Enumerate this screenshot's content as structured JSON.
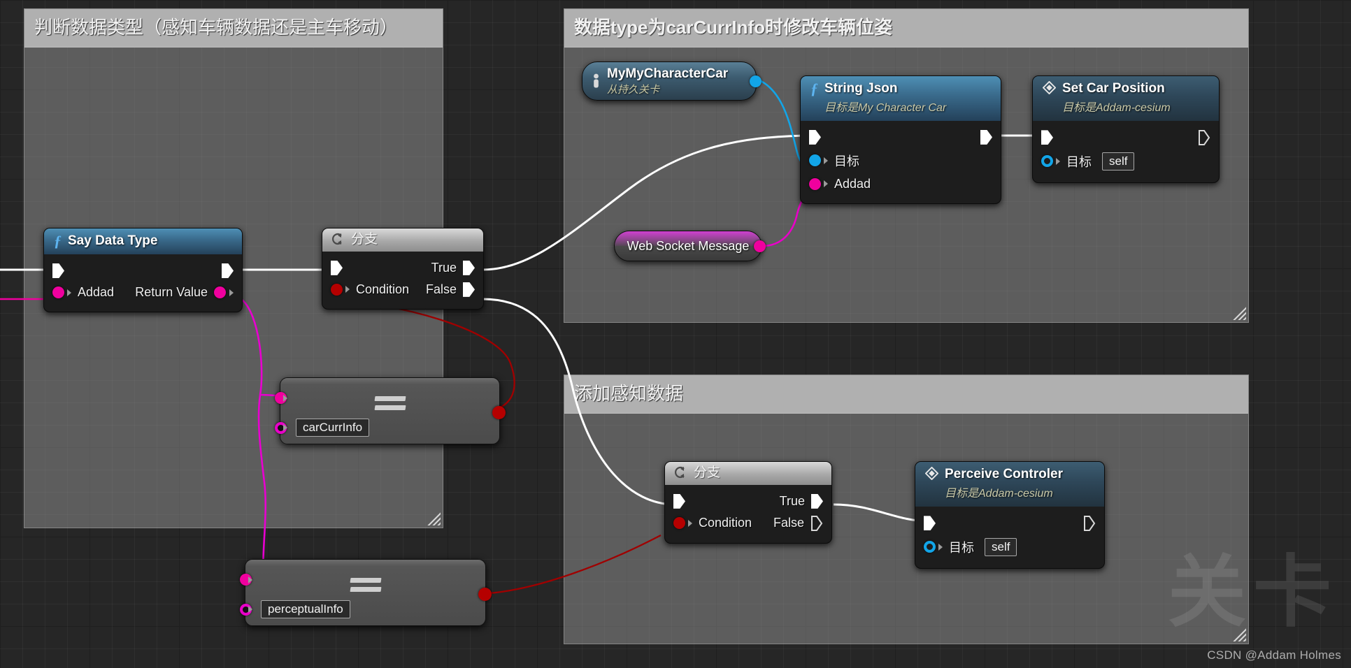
{
  "watermark": {
    "big": "关卡",
    "credit": "CSDN @Addam Holmes"
  },
  "comments": [
    {
      "id": "comment-data-type",
      "title": "判断数据类型（感知车辆数据还是主车移动）"
    },
    {
      "id": "comment-car-pose",
      "title": "数据type为carCurrInfo时修改车辆位姿"
    },
    {
      "id": "comment-perception",
      "title": "添加感知数据"
    }
  ],
  "nodes": {
    "my_character_car": {
      "title": "MyMyCharacterCar",
      "subtitle": "从持久关卡",
      "icon": "person-icon",
      "out_pin": "cyan"
    },
    "string_json": {
      "title": "String Json",
      "subtitle": "目标是My Character Car",
      "icon": "function-icon",
      "inputs": [
        {
          "label": "目标",
          "pin": "cyan"
        },
        {
          "label": "Addad",
          "pin": "magenta"
        }
      ]
    },
    "set_car_position": {
      "title": "Set Car Position",
      "subtitle": "目标是Addam-cesium",
      "icon": "diamond-icon",
      "inputs": [
        {
          "label": "目标",
          "pin": "cyan-ring",
          "value": "self"
        }
      ]
    },
    "web_socket_message": {
      "title": "Web Socket Message",
      "out_pin": "magenta"
    },
    "say_data_type": {
      "title": "Say Data Type",
      "icon": "function-icon",
      "input_label": "Addad",
      "output_label": "Return Value"
    },
    "branch_top": {
      "title": "分支",
      "icon": "branch-icon",
      "condition_label": "Condition",
      "true_label": "True",
      "false_label": "False"
    },
    "branch_bottom": {
      "title": "分支",
      "icon": "branch-icon",
      "condition_label": "Condition",
      "true_label": "True",
      "false_label": "False"
    },
    "equal_car_curr_info": {
      "operator": "==",
      "value": "carCurrInfo",
      "selected": false
    },
    "equal_perceptual_info": {
      "operator": "==",
      "value": "perceptualInfo",
      "selected": true
    },
    "perceive_controler": {
      "title": "Perceive Controler",
      "subtitle": "目标是Addam-cesium",
      "icon": "diamond-icon",
      "inputs": [
        {
          "label": "目标",
          "pin": "cyan-ring",
          "value": "self"
        }
      ]
    }
  },
  "colors": {
    "exec_wire": "#ffffff",
    "object_wire": "#12a5e8",
    "string_wire": "#f0009e",
    "bool_wire": "#a00000",
    "selection": "#f0a000",
    "comment_fill": "#aaaaaa"
  }
}
